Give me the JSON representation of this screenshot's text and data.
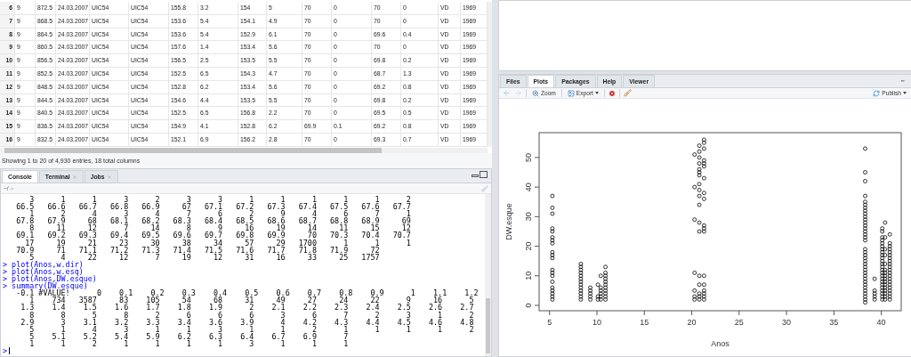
{
  "data_viewer": {
    "rows": [
      {
        "row_number": "6",
        "cells": [
          "9",
          "872.5",
          "24.03.2007",
          "UIC54",
          "UIC54",
          "155.8",
          "3.2",
          "154",
          "5",
          "70",
          "0",
          "70",
          "0",
          "VD",
          "1969"
        ]
      },
      {
        "row_number": "7",
        "cells": [
          "9",
          "868.5",
          "24.03.2007",
          "UIC54",
          "UIC54",
          "153.6",
          "5.4",
          "154.1",
          "4.9",
          "70",
          "0",
          "70",
          "0",
          "VD",
          "1969"
        ]
      },
      {
        "row_number": "8",
        "cells": [
          "9",
          "864.5",
          "24.03.2007",
          "UIC54",
          "UIC54",
          "153.6",
          "5.4",
          "152.9",
          "6.1",
          "70",
          "0",
          "69.6",
          "0.4",
          "VD",
          "1969"
        ]
      },
      {
        "row_number": "9",
        "cells": [
          "9",
          "860.5",
          "24.03.2007",
          "UIC54",
          "UIC54",
          "157.6",
          "1.4",
          "153.4",
          "5.6",
          "70",
          "0",
          "70",
          "0",
          "VD",
          "1969"
        ]
      },
      {
        "row_number": "10",
        "cells": [
          "9",
          "856.5",
          "24.03.2007",
          "UIC54",
          "UIC54",
          "156.5",
          "2.5",
          "153.5",
          "5.5",
          "70",
          "0",
          "69.8",
          "0.2",
          "VD",
          "1969"
        ]
      },
      {
        "row_number": "11",
        "cells": [
          "9",
          "852.5",
          "24.03.2007",
          "UIC54",
          "UIC54",
          "152.5",
          "6.5",
          "154.3",
          "4.7",
          "70",
          "0",
          "68.7",
          "1.3",
          "VD",
          "1969"
        ]
      },
      {
        "row_number": "12",
        "cells": [
          "9",
          "848.5",
          "24.03.2007",
          "UIC54",
          "UIC54",
          "152.8",
          "6.2",
          "153.4",
          "5.6",
          "70",
          "0",
          "69.2",
          "0.8",
          "VD",
          "1969"
        ]
      },
      {
        "row_number": "13",
        "cells": [
          "9",
          "844.5",
          "24.03.2007",
          "UIC54",
          "UIC54",
          "154.6",
          "4.4",
          "153.5",
          "5.5",
          "70",
          "0",
          "69.8",
          "0.2",
          "VD",
          "1969"
        ]
      },
      {
        "row_number": "14",
        "cells": [
          "9",
          "840.5",
          "24.03.2007",
          "UIC54",
          "UIC54",
          "152.5",
          "6.5",
          "156.8",
          "2.2",
          "70",
          "0",
          "69.5",
          "0.5",
          "VD",
          "1969"
        ]
      },
      {
        "row_number": "15",
        "cells": [
          "9",
          "836.5",
          "24.03.2007",
          "UIC54",
          "UIC54",
          "154.9",
          "4.1",
          "152.8",
          "6.2",
          "69.9",
          "0.1",
          "69.2",
          "0.8",
          "VD",
          "1969"
        ]
      },
      {
        "row_number": "16",
        "cells": [
          "9",
          "832.5",
          "24.03.2007",
          "UIC54",
          "UIC54",
          "152.1",
          "6.9",
          "156.2",
          "2.8",
          "70",
          "0",
          "69.3",
          "0.7",
          "VD",
          "1969"
        ]
      }
    ],
    "status": "Showing 1 to 20 of 4,930 entries, 18 total columns"
  },
  "console_pane": {
    "tabs": [
      {
        "label": "Console",
        "selected": true,
        "closable": false
      },
      {
        "label": "Terminal",
        "selected": false,
        "closable": true
      },
      {
        "label": "Jobs",
        "selected": false,
        "closable": true
      }
    ],
    "path": "~/",
    "lines": [
      {
        "kind": "output",
        "cells": [
          "3",
          "1",
          "1",
          "3",
          "2",
          "3",
          "3",
          "1",
          "1",
          "1",
          "1",
          "1",
          "2"
        ]
      },
      {
        "kind": "output",
        "cells": [
          "66.5",
          "66.6",
          "66.7",
          "66.8",
          "66.9",
          "67",
          "67.1",
          "67.2",
          "67.3",
          "67.4",
          "67.5",
          "67.6",
          "67.7"
        ]
      },
      {
        "kind": "output",
        "cells": [
          "1",
          "2",
          "4",
          "3",
          "4",
          "7",
          "6",
          "2",
          "9",
          "4",
          "6",
          "7",
          "1"
        ]
      },
      {
        "kind": "output",
        "cells": [
          "67.8",
          "67.9",
          "68",
          "68.1",
          "68.2",
          "68.3",
          "68.4",
          "68.5",
          "68.6",
          "68.7",
          "68.8",
          "68.9",
          "69"
        ]
      },
      {
        "kind": "output",
        "cells": [
          "8",
          "11",
          "12",
          "7",
          "14",
          "8",
          "9",
          "16",
          "19",
          "14",
          "11",
          "15",
          "12"
        ]
      },
      {
        "kind": "output",
        "cells": [
          "69.1",
          "69.2",
          "69.3",
          "69.4",
          "69.5",
          "69.6",
          "69.7",
          "69.8",
          "69.9",
          "70",
          "70.3",
          "70.4",
          "70.7"
        ]
      },
      {
        "kind": "output",
        "cells": [
          "17",
          "19",
          "21",
          "23",
          "30",
          "38",
          "34",
          "57",
          "29",
          "1700",
          "1",
          "1",
          "1"
        ]
      },
      {
        "kind": "output",
        "cells": [
          "70.9",
          "71",
          "71.1",
          "71.2",
          "71.3",
          "71.4",
          "71.5",
          "71.6",
          "71.7",
          "71.8",
          "71.9",
          "72"
        ]
      },
      {
        "kind": "output",
        "cells": [
          "5",
          "4",
          "22",
          "12",
          "7",
          "19",
          "12",
          "31",
          "16",
          "33",
          "25",
          "1757"
        ]
      },
      {
        "kind": "command",
        "text": "> plot(Anos,w.dir)"
      },
      {
        "kind": "command",
        "text": "> plot(Anos,w.esq)"
      },
      {
        "kind": "command",
        "text": "> plot(Anos,DW.esque)"
      },
      {
        "kind": "command",
        "text": "> summary(DW.esque)"
      },
      {
        "kind": "output",
        "cells": [
          "-0.1",
          "#VALUE!",
          "0",
          "0.1",
          "0.2",
          "0.3",
          "0.4",
          "0.5",
          "0.6",
          "0.7",
          "0.8",
          "0.9",
          "1",
          "1.1",
          "1.2"
        ]
      },
      {
        "kind": "output",
        "cells": [
          "1",
          "734",
          "3587",
          "83",
          "105",
          "54",
          "68",
          "31",
          "49",
          "27",
          "24",
          "22",
          "9",
          "16",
          "5"
        ]
      },
      {
        "kind": "output",
        "cells": [
          "1.3",
          "1.4",
          "1.5",
          "1.6",
          "1.7",
          "1.8",
          "1.9",
          "2",
          "2.1",
          "2.2",
          "2.3",
          "2.4",
          "2.5",
          "2.6",
          "2.7"
        ]
      },
      {
        "kind": "output",
        "cells": [
          "8",
          "8",
          "5",
          "8",
          "2",
          "6",
          "6",
          "6",
          "3",
          "6",
          "7",
          "2",
          "3",
          "1",
          "2"
        ]
      },
      {
        "kind": "output",
        "cells": [
          "2.9",
          "3",
          "3.1",
          "3.2",
          "3.3",
          "3.4",
          "3.6",
          "3.9",
          "4",
          "4.2",
          "4.3",
          "4.4",
          "4.5",
          "4.6",
          "4.8"
        ]
      },
      {
        "kind": "output",
        "cells": [
          "5",
          "1",
          "4",
          "3",
          "1",
          "1",
          "3",
          "1",
          "1",
          "2",
          "1",
          "1",
          "1",
          "1",
          "2"
        ]
      },
      {
        "kind": "output",
        "cells": [
          "5",
          "5.1",
          "5.2",
          "5.4",
          "5.9",
          "6.2",
          "6.3",
          "6.4",
          "6.7",
          "6.9",
          "7"
        ]
      },
      {
        "kind": "output",
        "cells": [
          "1",
          "1",
          "2",
          "1",
          "1",
          "1",
          "1",
          "3",
          "1",
          "1",
          "1"
        ]
      },
      {
        "kind": "prompt",
        "text": ">"
      }
    ]
  },
  "plots_pane": {
    "tabs": [
      {
        "label": "Files",
        "selected": false
      },
      {
        "label": "Plots",
        "selected": true
      },
      {
        "label": "Packages",
        "selected": false
      },
      {
        "label": "Help",
        "selected": false
      },
      {
        "label": "Viewer",
        "selected": false
      }
    ],
    "toolbar": {
      "zoom": "Zoom",
      "export": "Export",
      "publish": "Publish"
    },
    "chart_data": {
      "type": "scatter",
      "xlabel": "Anos",
      "ylabel": "DW.esque",
      "xlim": [
        3.9,
        42.1
      ],
      "ylim": [
        -1.8,
        58.4
      ],
      "xticks": [
        5,
        10,
        15,
        20,
        25,
        30,
        35,
        40
      ],
      "yticks": [
        0,
        10,
        20,
        30,
        40,
        50
      ],
      "x": [
        5.3,
        5.3,
        5.3,
        5.3,
        5.3,
        5.3,
        5.3,
        5.3,
        5.3,
        5.3,
        5.3,
        5.3,
        5.3,
        5.3,
        5.3,
        5.3,
        5.3,
        5.3,
        5.3,
        5.3,
        8.3,
        8.3,
        8.3,
        8.3,
        8.3,
        8.3,
        8.3,
        8.3,
        8.3,
        8.3,
        8.3,
        8.3,
        8.3,
        9.3,
        9.3,
        9.3,
        9.3,
        9.3,
        10.1,
        10.1,
        10.1,
        10.4,
        10.4,
        10.4,
        10.4,
        10.4,
        10.4,
        10.9,
        10.9,
        10.9,
        10.9,
        10.9,
        10.9,
        10.9,
        10.9,
        10.9,
        10.9,
        10.9,
        20.3,
        20.3,
        20.3,
        20.3,
        20.3,
        20.3,
        20.3,
        20.8,
        20.8,
        20.8,
        20.8,
        20.8,
        20.8,
        20.8,
        20.8,
        20.8,
        20.8,
        20.8,
        20.8,
        20.8,
        20.8,
        20.8,
        20.8,
        20.8,
        20.8,
        21.3,
        21.3,
        21.3,
        21.3,
        21.3,
        21.3,
        21.3,
        21.3,
        21.3,
        21.3,
        21.3,
        21.3,
        21.3,
        21.3,
        21.3,
        21.3,
        21.3,
        21.3,
        38.3,
        38.3,
        38.3,
        38.3,
        38.3,
        38.3,
        38.3,
        38.3,
        38.3,
        38.3,
        38.3,
        38.3,
        38.3,
        38.3,
        38.3,
        38.3,
        38.3,
        38.3,
        38.3,
        38.3,
        38.3,
        38.3,
        38.3,
        38.3,
        38.3,
        38.3,
        38.3,
        38.3,
        38.3,
        38.3,
        38.3,
        38.3,
        38.3,
        38.3,
        38.3,
        38.3,
        38.3,
        39.3,
        39.3,
        39.3,
        39.3,
        39.3,
        40.1,
        40.1,
        40.1,
        40.1,
        40.1,
        40.1,
        40.1,
        40.1,
        40.1,
        40.1,
        40.1,
        40.1,
        40.1,
        40.1,
        40.1,
        40.1,
        40.1,
        40.1,
        40.1,
        40.1,
        40.1,
        40.1,
        40.1,
        40.1,
        40.4,
        40.4,
        40.4,
        40.4,
        40.4,
        40.4,
        40.4,
        40.4,
        40.4,
        40.4,
        40.4,
        40.4,
        40.4,
        40.4,
        40.4,
        40.4,
        40.9,
        40.9,
        40.9,
        40.9,
        40.9,
        40.9,
        40.9,
        40.9,
        40.9,
        40.9,
        40.9,
        40.9,
        40.9,
        40.9,
        40.9,
        40.9,
        40.9,
        40.9,
        40.9,
        40.9,
        40.9
      ],
      "series": [
        {
          "color": "#000000",
          "values": [
            2,
            3,
            4,
            5,
            6,
            8,
            10,
            11,
            12,
            16,
            17,
            18,
            21,
            22,
            23,
            25,
            26,
            31,
            33,
            37,
            2,
            3,
            4,
            5,
            6,
            7,
            8,
            9,
            10,
            11,
            12,
            13,
            14,
            2,
            3,
            4,
            5,
            6,
            2,
            3,
            7,
            2,
            3,
            4,
            5,
            6,
            10,
            2,
            3,
            4,
            5,
            6,
            7,
            8,
            9,
            10,
            11,
            13,
            2,
            3,
            5,
            11,
            29,
            40,
            51,
            2,
            3,
            4,
            7,
            10,
            25,
            28,
            34,
            37,
            39,
            41,
            44,
            45,
            46,
            48,
            50,
            52,
            54,
            2,
            3,
            4,
            5,
            7,
            10,
            25,
            26,
            27,
            36,
            38,
            43,
            47,
            48,
            49,
            53,
            55,
            56,
            1,
            2,
            3,
            4,
            5,
            6,
            7,
            8,
            9,
            10,
            11,
            12,
            13,
            14,
            15,
            16,
            17,
            18,
            19,
            22,
            23,
            24,
            25,
            26,
            27,
            28,
            29,
            30,
            31,
            32,
            33,
            34,
            35,
            37,
            42,
            45,
            53,
            2,
            3,
            4,
            5,
            9,
            2,
            3,
            4,
            5,
            6,
            7,
            8,
            9,
            10,
            11,
            12,
            13,
            14,
            15,
            16,
            17,
            18,
            19,
            20,
            21,
            22,
            23,
            25,
            26,
            2,
            3,
            4,
            5,
            6,
            7,
            8,
            9,
            10,
            11,
            12,
            14,
            17,
            19,
            23,
            28,
            2,
            3,
            4,
            5,
            6,
            7,
            8,
            9,
            10,
            11,
            12,
            13,
            14,
            15,
            16,
            17,
            18,
            19,
            20,
            21,
            24
          ]
        }
      ]
    }
  }
}
